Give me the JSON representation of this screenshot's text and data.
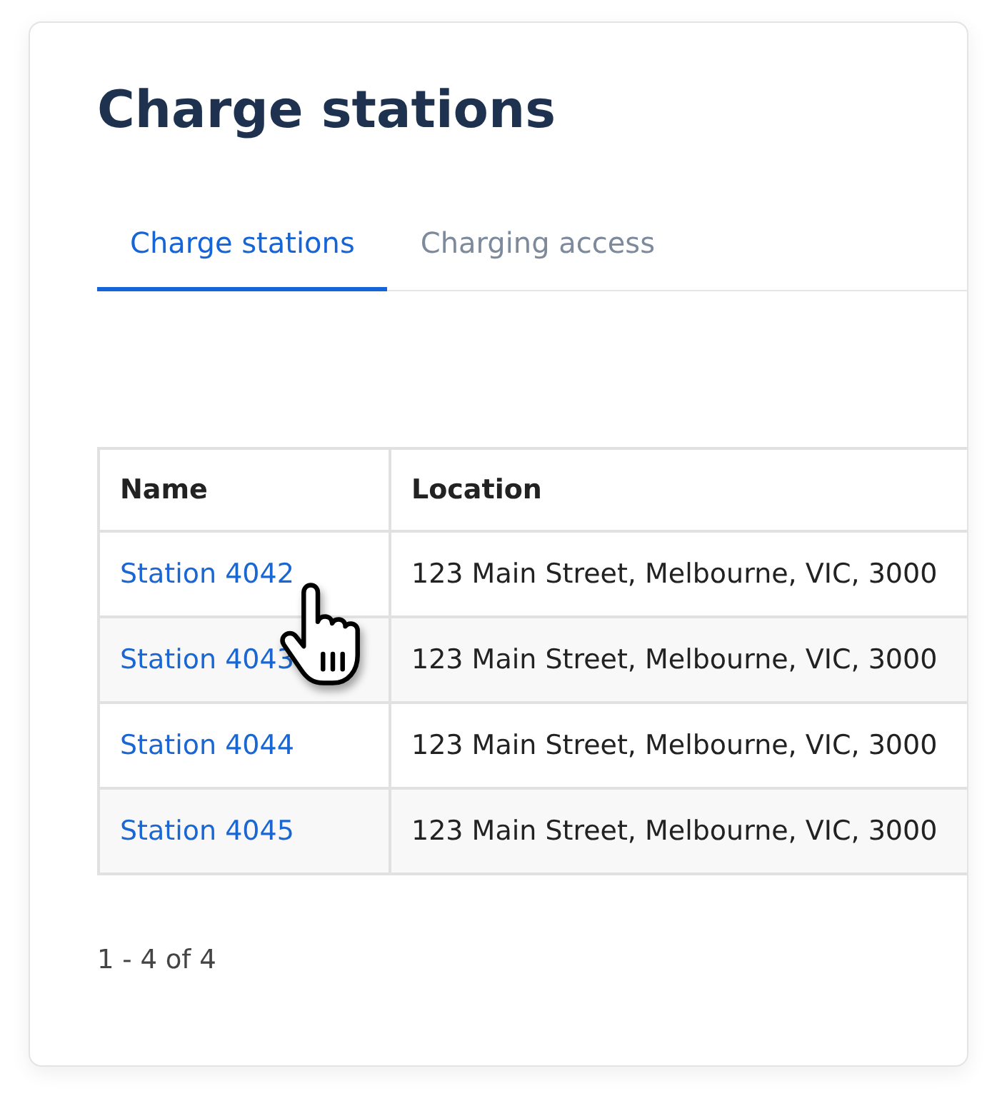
{
  "page": {
    "title": "Charge stations"
  },
  "tabs": [
    {
      "label": "Charge stations",
      "selected": true
    },
    {
      "label": "Charging access",
      "selected": false
    }
  ],
  "table": {
    "columns": [
      "Name",
      "Location"
    ],
    "rows": [
      {
        "name": "Station 4042",
        "location": "123 Main Street, Melbourne, VIC, 3000"
      },
      {
        "name": "Station 4043",
        "location": "123 Main Street, Melbourne, VIC, 3000"
      },
      {
        "name": "Station 4044",
        "location": "123 Main Street, Melbourne, VIC, 3000"
      },
      {
        "name": "Station 4045",
        "location": "123 Main Street, Melbourne, VIC, 3000"
      }
    ]
  },
  "pagination": {
    "summary": "1 - 4 of 4"
  }
}
